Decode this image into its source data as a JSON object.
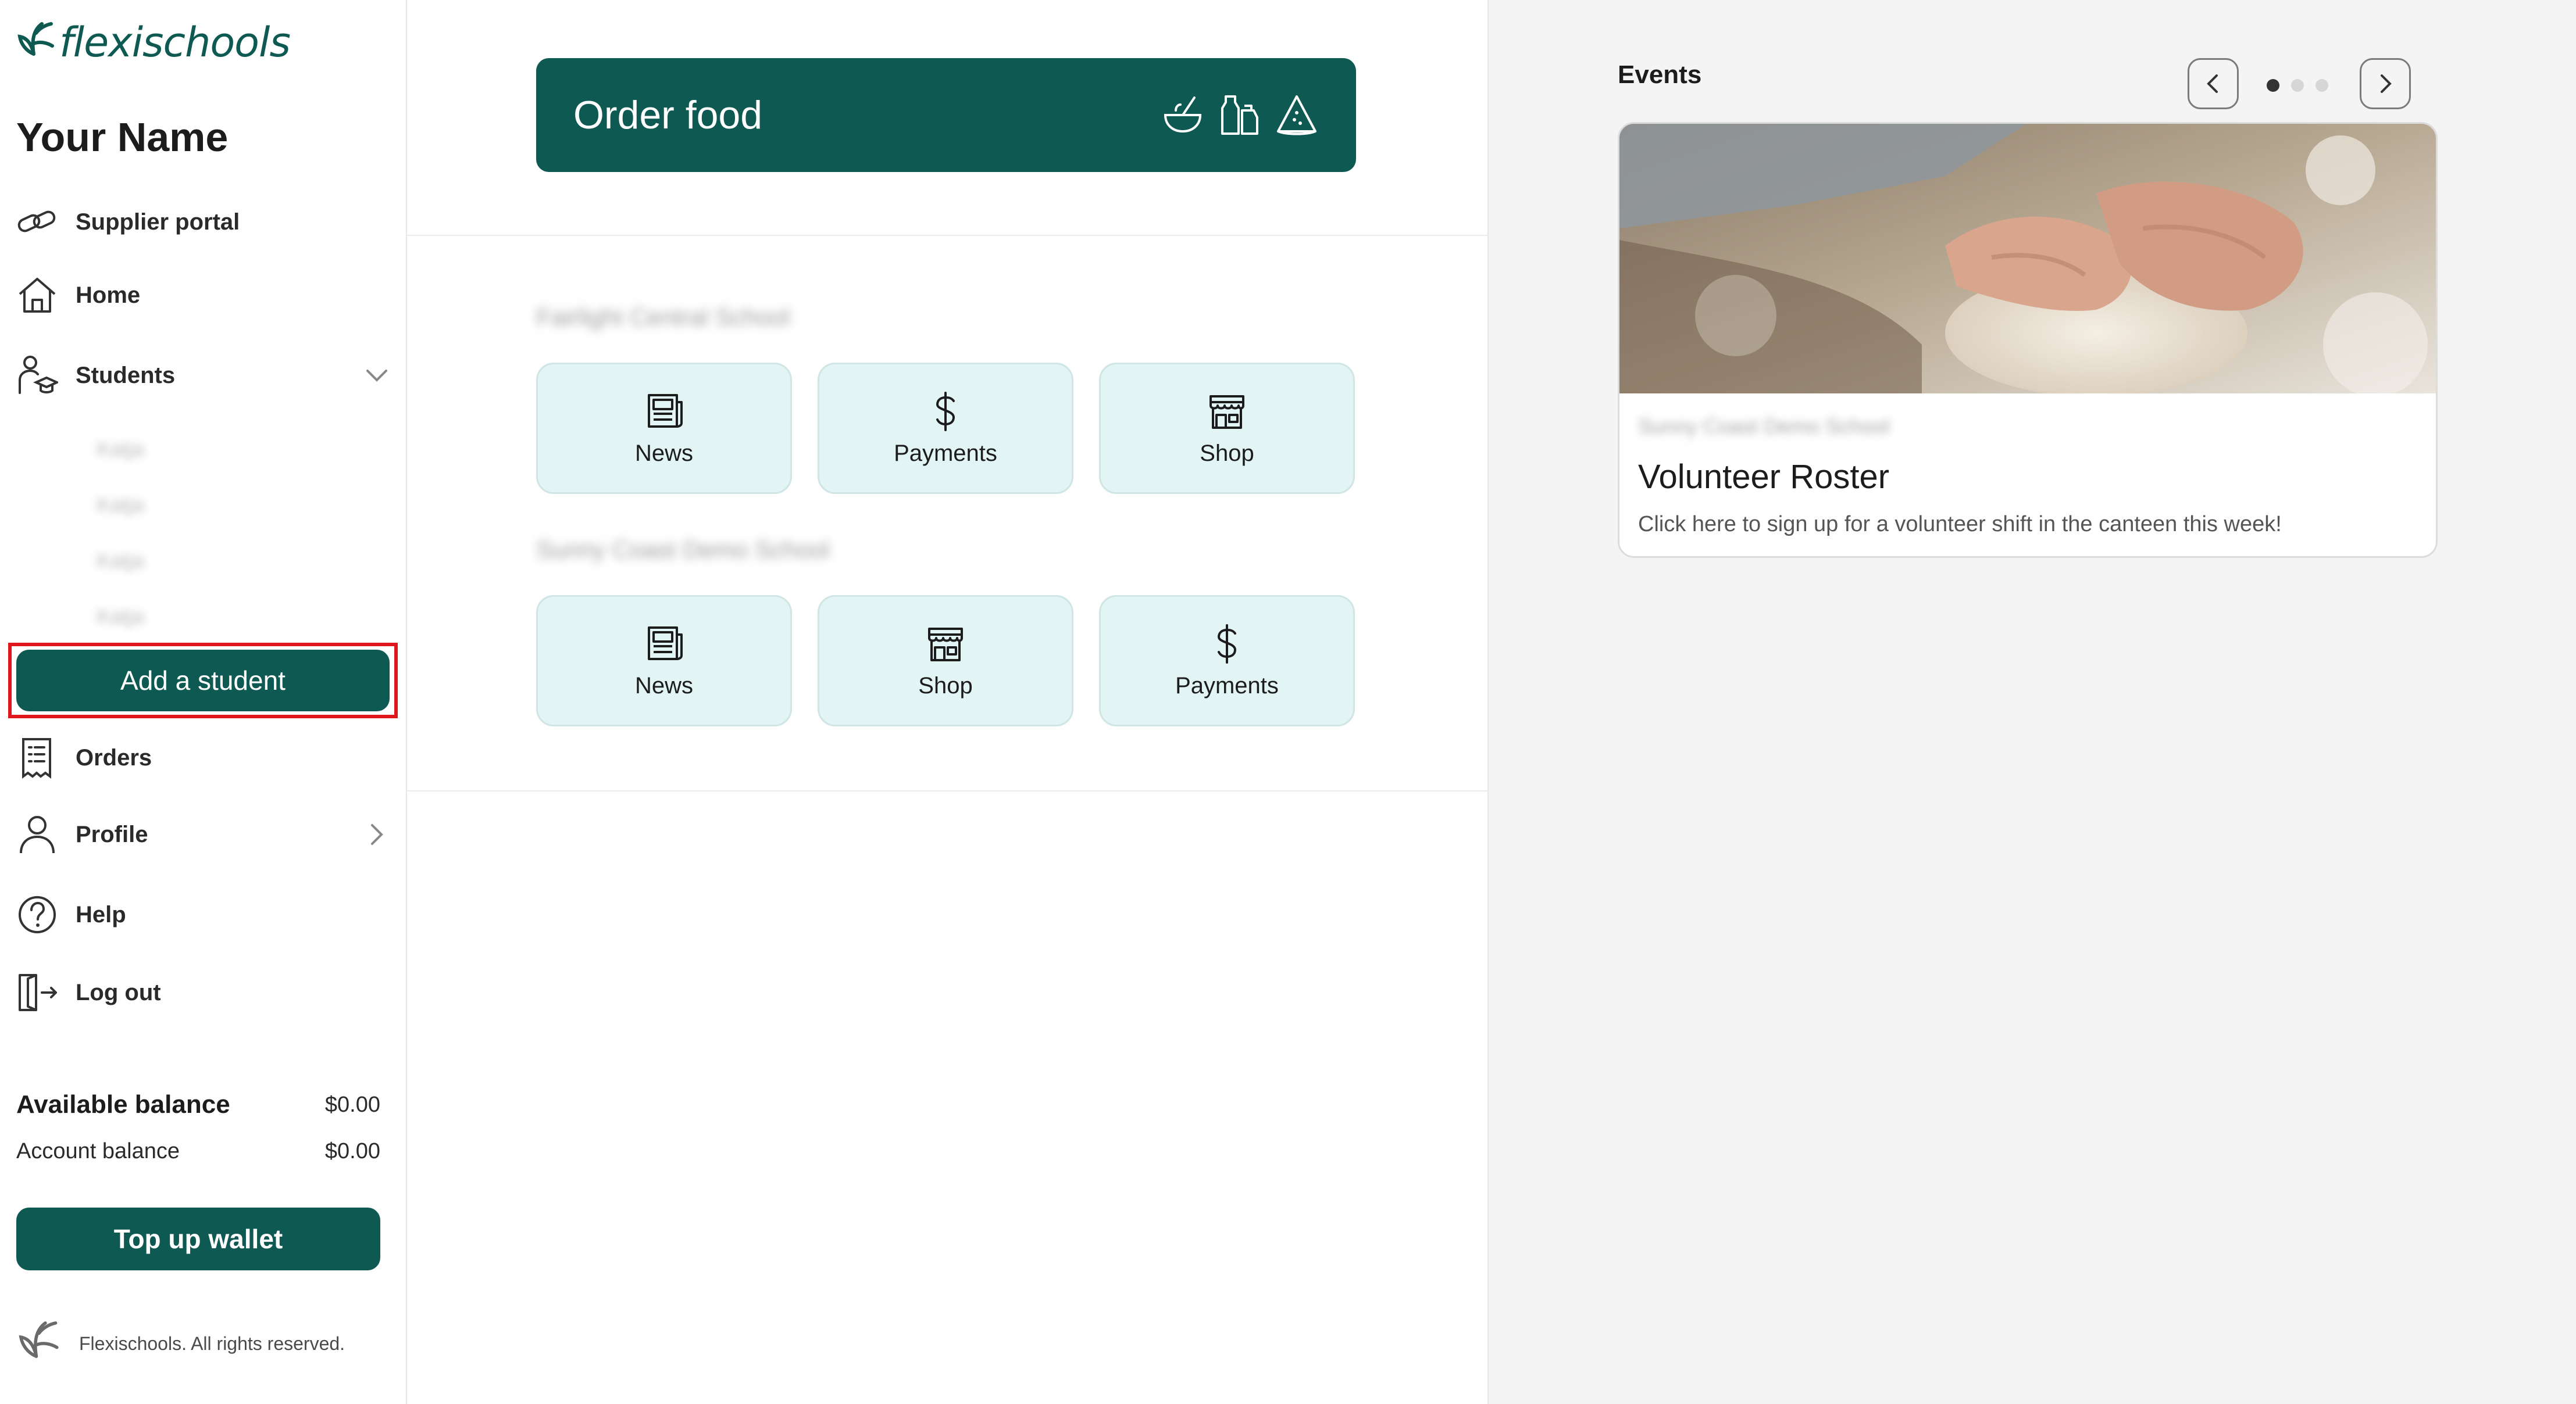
{
  "sidebar": {
    "brand": "flexischools",
    "user_name": "Your Name",
    "nav": {
      "supplier_portal": "Supplier portal",
      "home": "Home",
      "students": "Students",
      "orders": "Orders",
      "profile": "Profile",
      "help": "Help",
      "log_out": "Log out"
    },
    "students_list": [
      "Katja",
      "Katja",
      "Katja",
      "Katja"
    ],
    "add_student_label": "Add a student",
    "balances": {
      "available_label": "Available balance",
      "available_value": "$0.00",
      "account_label": "Account balance",
      "account_value": "$0.00"
    },
    "topup_label": "Top up wallet",
    "footer_text": "Flexischools. All rights reserved."
  },
  "main": {
    "order_food_label": "Order food",
    "schools": [
      {
        "name": "Fairlight Central School",
        "tiles": [
          "News",
          "Payments",
          "Shop"
        ]
      },
      {
        "name": "Sunny Coast Demo School",
        "tiles": [
          "News",
          "Shop",
          "Payments"
        ]
      }
    ]
  },
  "events": {
    "title": "Events",
    "active_slide": 1,
    "slide_count": 3,
    "card": {
      "school": "Sunny Coast Demo School",
      "title": "Volunteer Roster",
      "description": "Click here to sign up for a volunteer shift in the canteen this week!"
    }
  },
  "colors": {
    "brand": "#0e5a53",
    "tile_bg": "#e2f4f3",
    "highlight": "#e0161d",
    "panel_bg": "#f4f4f4"
  },
  "icons": [
    "leaf-logo-icon",
    "link-icon",
    "home-icon",
    "student-icon",
    "chevron-down-icon",
    "receipt-icon",
    "person-icon",
    "chevron-right-icon",
    "help-icon",
    "logout-icon",
    "bowl-icon",
    "bottle-icon",
    "watermelon-icon",
    "newspaper-icon",
    "dollar-icon",
    "store-icon",
    "chevron-left-icon"
  ]
}
